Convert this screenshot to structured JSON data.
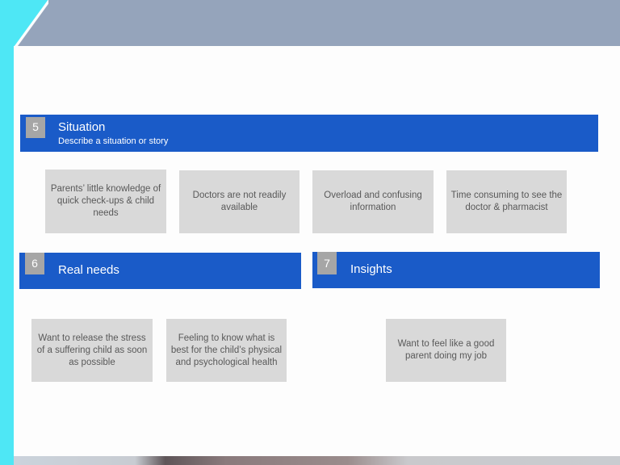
{
  "slide": {
    "colors": {
      "header_blue": "#1a5bc8",
      "number_badge_gray": "#a6a6a6",
      "card_gray": "#d9d9d9",
      "top_band": "#95a4bb",
      "accent_cyan": "#4ee7f5"
    },
    "situation": {
      "number": "5",
      "title": "Situation",
      "subtitle": "Describe a situation or story",
      "cards": [
        "Parents’ little knowledge of quick check-ups & child needs",
        "Doctors are not readily available",
        "Overload and confusing information",
        "Time consuming to see the doctor  & pharmacist"
      ]
    },
    "real_needs": {
      "number": "6",
      "title": "Real needs",
      "cards": [
        "Want to release the stress of a suffering child as soon as possible",
        "Feeling to know  what is best for the child’s physical and psychological health"
      ]
    },
    "insights": {
      "number": "7",
      "title": "Insights",
      "cards": [
        "Want to feel like a good parent doing my job"
      ]
    }
  }
}
